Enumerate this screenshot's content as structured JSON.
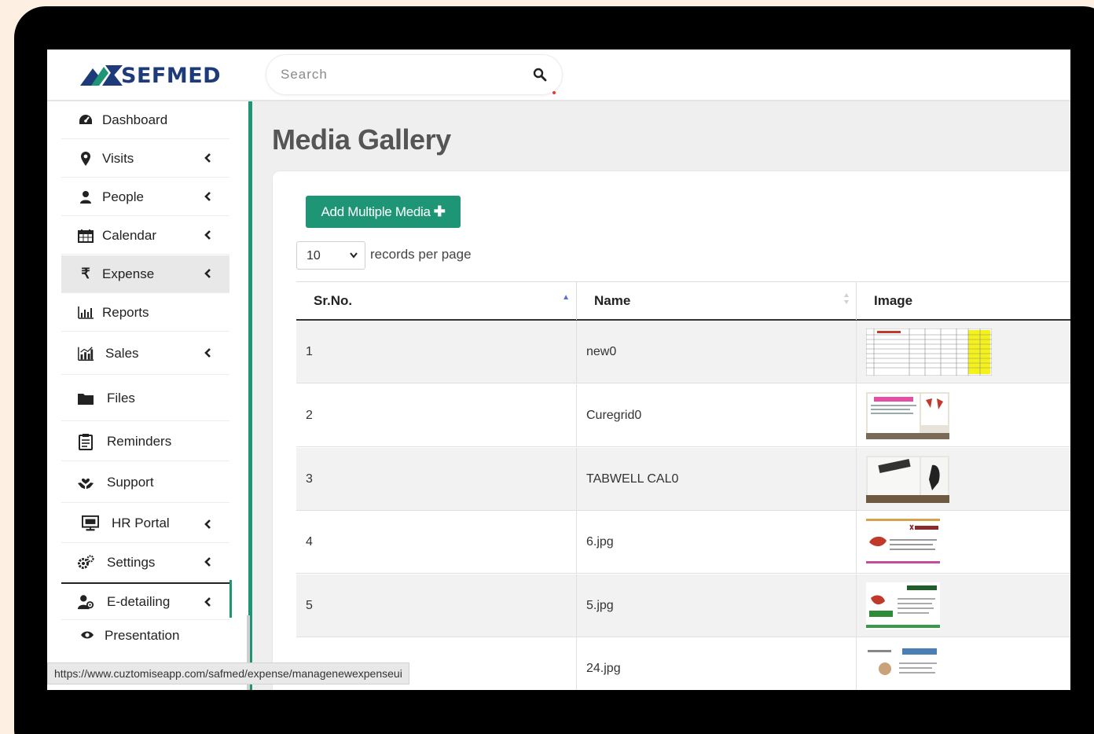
{
  "brand": {
    "name": "SEFMED",
    "colors": {
      "primary": "#1e9575",
      "logo": "#1d3b78"
    }
  },
  "search": {
    "placeholder": "Search"
  },
  "sidebar": {
    "items": [
      {
        "label": "Dashboard",
        "icon": "dashboard-icon",
        "has_chevron": false
      },
      {
        "label": "Visits",
        "icon": "map-marker-icon",
        "has_chevron": true
      },
      {
        "label": "People",
        "icon": "user-icon",
        "has_chevron": true
      },
      {
        "label": "Calendar",
        "icon": "calendar-icon",
        "has_chevron": true
      },
      {
        "label": "Expense",
        "icon": "rupee-icon",
        "has_chevron": true,
        "active": true
      },
      {
        "label": "Reports",
        "icon": "bar-chart-icon",
        "has_chevron": false
      },
      {
        "label": "Sales",
        "icon": "sales-chart-icon",
        "has_chevron": true
      },
      {
        "label": "Files",
        "icon": "folder-icon",
        "has_chevron": false
      },
      {
        "label": "Reminders",
        "icon": "clipboard-icon",
        "has_chevron": false
      },
      {
        "label": "Support",
        "icon": "hands-heart-icon",
        "has_chevron": false
      },
      {
        "label": "HR Portal",
        "icon": "monitor-icon",
        "has_chevron": true
      },
      {
        "label": "Settings",
        "icon": "gears-icon",
        "has_chevron": true
      },
      {
        "label": "E-detailing",
        "icon": "user-gear-icon",
        "has_chevron": true
      }
    ],
    "subitems": [
      {
        "label": "Presentation",
        "icon": "eye-icon"
      }
    ]
  },
  "main": {
    "title": "Media Gallery",
    "add_button": "Add Multiple Media",
    "records_per_page": {
      "value": "10",
      "label": "records per page"
    },
    "table": {
      "columns": [
        "Sr.No.",
        "Name",
        "Image"
      ],
      "rows": [
        {
          "sr": "1",
          "name": "new0",
          "image": "spreadsheet-thumbnail"
        },
        {
          "sr": "2",
          "name": "Curegrid0",
          "image": "brochure-thumbnail"
        },
        {
          "sr": "3",
          "name": "TABWELL CAL0",
          "image": "tablet-ad-thumbnail"
        },
        {
          "sr": "4",
          "name": "6.jpg",
          "image": "kariliv-thumbnail"
        },
        {
          "sr": "5",
          "name": "5.jpg",
          "image": "kariliv-green-thumbnail"
        },
        {
          "sr": "",
          "name": "24.jpg",
          "image": "beezyme-thumbnail"
        }
      ]
    }
  },
  "status_bar": {
    "url": "https://www.cuztomiseapp.com/safmed/expense/managenewexpenseui"
  }
}
